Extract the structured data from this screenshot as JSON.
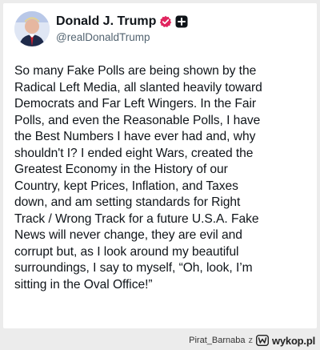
{
  "post": {
    "author": {
      "display_name": "Donald J. Trump",
      "handle": "@realDonaldTrump",
      "avatar_icon": "portrait-avatar",
      "verified_icon": "verified-badge-icon",
      "badge_icon": "plus-badge-icon"
    },
    "text": "So many Fake Polls are being shown by the\nRadical Left Media, all slanted heavily toward\nDemocrats and Far Left Wingers. In the Fair\nPolls, and even the Reasonable Polls, I have\nthe Best Numbers I have ever had and, why\nshouldn't I? I ended eight Wars, created the\nGreatest Economy in the History of our\nCountry, kept Prices, Inflation, and Taxes\ndown, and am setting standards for Right\nTrack / Wrong Track for a future U.S.A. Fake\nNews will never change, they are evil and\ncorrupt but, as I look around my beautiful\nsurroundings, I say to myself, “Oh, look, I’m\nsitting in the Oval Office!”"
  },
  "footer": {
    "username": "Pirat_Barnaba",
    "separator": "z",
    "site_logo": "wykop.pl",
    "site_icon": "wykop-icon"
  },
  "colors": {
    "background": "#ececec",
    "card": "#ffffff",
    "text": "#0f1419",
    "handle": "#536471",
    "verified": "#e0245e"
  }
}
